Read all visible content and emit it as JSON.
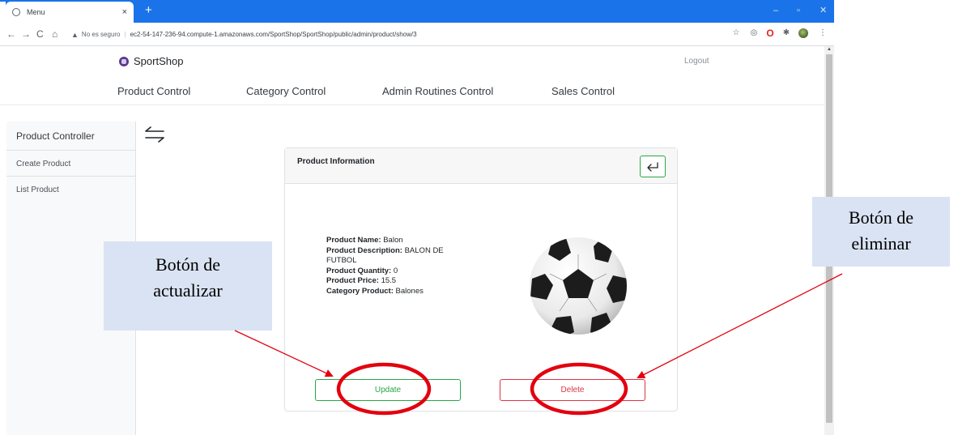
{
  "browser": {
    "tab_title": "Menu",
    "tab_close": "×",
    "new_tab": "+",
    "window_controls": {
      "minimize": "–",
      "maximize": "▫",
      "close": "✕"
    },
    "nav": {
      "back": "←",
      "forward": "→",
      "reload": "C",
      "home": "⌂"
    },
    "security_label": "No es seguro",
    "url": "ec2-54-147-236-94.compute-1.amazonaws.com/SportShop/SportShop/public/admin/product/show/3",
    "bookmark_icon": "star-icon",
    "menu_dots": "⋮"
  },
  "header": {
    "brand": "SportShop",
    "logout": "Logout"
  },
  "nav": {
    "items": [
      "Product Control",
      "Category Control",
      "Admin Routines Control",
      "Sales Control"
    ]
  },
  "sidebar": {
    "title": "Product Controller",
    "items": [
      "Create Product",
      "List Product"
    ]
  },
  "card": {
    "title": "Product Information",
    "fields": {
      "name_label": "Product Name:",
      "name_value": "Balon",
      "description_label": "Product Description:",
      "description_value": "BALON DE FUTBOL",
      "quantity_label": "Product Quantity:",
      "quantity_value": "0",
      "price_label": "Product Price:",
      "price_value": "15.5",
      "category_label": "Category Product:",
      "category_value": "Balones"
    },
    "update_label": "Update",
    "delete_label": "Delete"
  },
  "annotations": {
    "update_callout": [
      "Botón de",
      "actualizar"
    ],
    "delete_callout": [
      "Botón de",
      "eliminar"
    ],
    "highlight_color": "#e3000f"
  },
  "colors": {
    "browser_blue": "#1a73e8",
    "success": "#28a745",
    "danger": "#dc3545",
    "callout_bg": "#dae3f3"
  }
}
